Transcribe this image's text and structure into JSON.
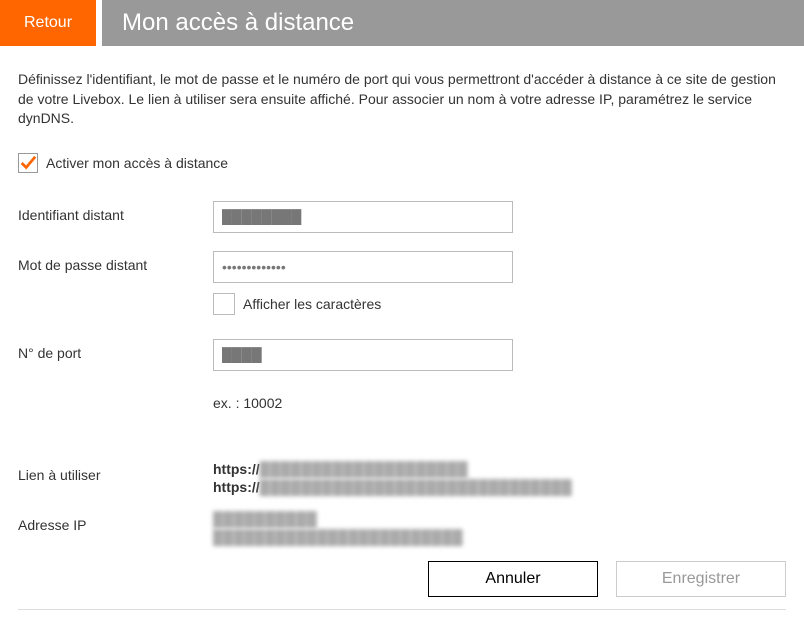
{
  "header": {
    "back_label": "Retour",
    "title": "Mon accès à distance"
  },
  "description": "Définissez l'identifiant, le mot de passe et le numéro de port qui vous permettront d'accéder à distance à ce site de gestion de votre Livebox. Le lien à utiliser sera ensuite affiché. Pour associer un nom à votre adresse IP, paramétrez le service dynDNS.",
  "activate": {
    "label": "Activer mon accès à distance",
    "checked": true
  },
  "fields": {
    "identifier": {
      "label": "Identifiant distant",
      "value": "████████"
    },
    "password": {
      "label": "Mot de passe distant",
      "value": "•••••••••••••"
    },
    "show_chars": {
      "label": "Afficher les caractères"
    },
    "port": {
      "label": "N° de port",
      "value": "████",
      "hint": "ex. : 10002"
    }
  },
  "link": {
    "label": "Lien à utiliser",
    "prefix": "https://",
    "value1": "████████████████████",
    "value2": "██████████████████████████████"
  },
  "ip": {
    "label": "Adresse IP",
    "value1": "██████████",
    "value2": "████████████████████████"
  },
  "buttons": {
    "cancel": "Annuler",
    "save": "Enregistrer"
  }
}
